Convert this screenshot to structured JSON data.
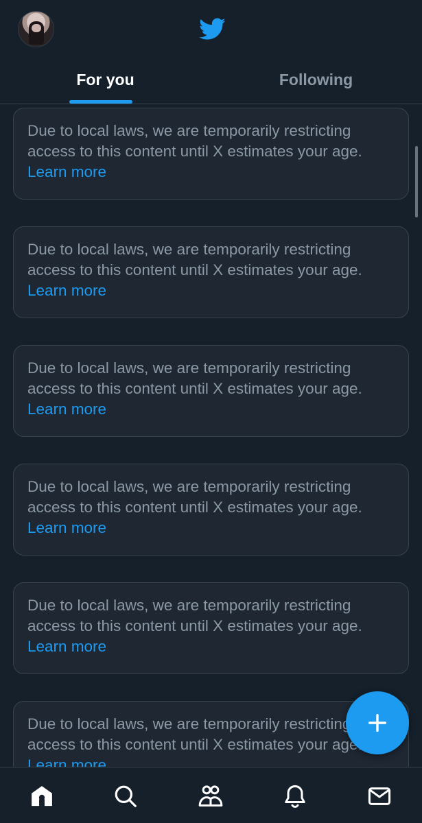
{
  "header": {
    "avatar_icon": "profile-avatar",
    "logo_icon": "twitter-bird-icon",
    "brand_color": "#1d9bf0"
  },
  "tabs": [
    {
      "label": "For you",
      "active": true
    },
    {
      "label": "Following",
      "active": false
    }
  ],
  "feed": {
    "notices": [
      {
        "message": "Due to local laws, we are temporarily restricting access to this content until X estimates your age.",
        "link": "Learn more"
      },
      {
        "message": "Due to local laws, we are temporarily restricting access to this content until X estimates your age.",
        "link": "Learn more"
      },
      {
        "message": "Due to local laws, we are temporarily restricting access to this content until X estimates your age.",
        "link": "Learn more"
      },
      {
        "message": "Due to local laws, we are temporarily restricting access to this content until X estimates your age.",
        "link": "Learn more"
      },
      {
        "message": "Due to local laws, we are temporarily restricting access to this content until X estimates your age.",
        "link": "Learn more"
      },
      {
        "message": "Due to local laws, we are temporarily restricting access to this content until X estimates your age.",
        "link": "Learn more"
      }
    ]
  },
  "fab": {
    "icon": "plus-icon"
  },
  "bottom_nav": [
    {
      "icon": "home-icon",
      "active": true
    },
    {
      "icon": "search-icon",
      "active": false
    },
    {
      "icon": "communities-icon",
      "active": false
    },
    {
      "icon": "bell-icon",
      "active": false
    },
    {
      "icon": "mail-icon",
      "active": false
    }
  ],
  "colors": {
    "background": "#15202b",
    "card": "#1e2732",
    "border": "#38444d",
    "muted_text": "#8b98a5",
    "accent": "#1d9bf0"
  }
}
